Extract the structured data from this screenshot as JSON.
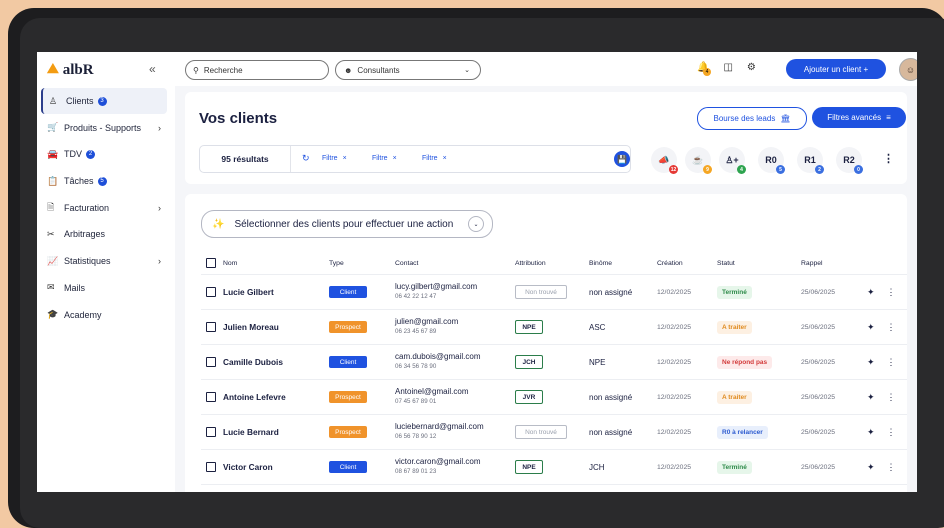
{
  "app": {
    "logo": "albR"
  },
  "sidebar": {
    "items": [
      {
        "label": "Clients",
        "icon": "user-icon",
        "badge": "3",
        "active": true,
        "chevron": false
      },
      {
        "label": "Produits - Supports",
        "icon": "cart-icon",
        "badge": "",
        "chevron": true
      },
      {
        "label": "TDV",
        "icon": "car-icon",
        "badge": "2",
        "chevron": false
      },
      {
        "label": "Tâches",
        "icon": "clipboard-icon",
        "badge": "5",
        "chevron": false
      },
      {
        "label": "Facturation",
        "icon": "invoice-icon",
        "badge": "",
        "chevron": true
      },
      {
        "label": "Arbitrages",
        "icon": "scissors-icon",
        "badge": "",
        "chevron": false
      },
      {
        "label": "Statistiques",
        "icon": "chart-icon",
        "badge": "",
        "chevron": true
      },
      {
        "label": "Mails",
        "icon": "mail-icon",
        "badge": "",
        "chevron": false
      },
      {
        "label": "Academy",
        "icon": "graduation-icon",
        "badge": "",
        "chevron": false
      }
    ]
  },
  "topbar": {
    "search_placeholder": "Recherche",
    "consultants_label": "Consultants",
    "add_client_label": "Ajouter un client +",
    "notification_count": "4"
  },
  "main": {
    "title": "Vos clients",
    "bourse_label": "Bourse des leads",
    "filtres_label": "Filtres avancés",
    "results": "95 résultats",
    "filters": [
      "Filtre",
      "Filtre",
      "Filtre"
    ],
    "stats": [
      {
        "label": "",
        "icon": "megaphone-icon",
        "count": "12",
        "color": "#e53935"
      },
      {
        "label": "",
        "icon": "pot-icon",
        "count": "9",
        "color": "#f5a623"
      },
      {
        "label": "",
        "icon": "add-person-icon",
        "count": "4",
        "color": "#2ea44f"
      },
      {
        "label": "R0",
        "icon": "",
        "count": "5",
        "color": "#3b6fe0"
      },
      {
        "label": "R1",
        "icon": "",
        "count": "2",
        "color": "#3b6fe0"
      },
      {
        "label": "R2",
        "icon": "",
        "count": "0",
        "color": "#3b6fe0"
      }
    ],
    "select_action": "Sélectionner des clients  pour effectuer une action"
  },
  "table": {
    "headers": [
      "Nom",
      "Type",
      "Contact",
      "Attribution",
      "Binôme",
      "Création",
      "Statut",
      "Rappel"
    ],
    "rows": [
      {
        "name": "Lucie Gilbert",
        "type": "Client",
        "email": "lucy.gilbert@gmail.com",
        "phone": "06 42 22 12 47",
        "attribution": "Non trouvé",
        "binome": "non assigné",
        "creation": "12/02/2025",
        "statut": "Terminé",
        "rappel": "25/06/2025"
      },
      {
        "name": "Julien Moreau",
        "type": "Prospect",
        "email": "julien@gmail.com",
        "phone": "06 23 45 67 89",
        "attribution": "NPE",
        "binome": "ASC",
        "creation": "12/02/2025",
        "statut": "A traiter",
        "rappel": "25/06/2025"
      },
      {
        "name": "Camille Dubois",
        "type": "Client",
        "email": "cam.dubois@gmail.com",
        "phone": "06 34 56 78 90",
        "attribution": "JCH",
        "binome": "NPE",
        "creation": "12/02/2025",
        "statut": "Ne répond pas",
        "rappel": "25/06/2025"
      },
      {
        "name": "Antoine Lefevre",
        "type": "Prospect",
        "email": "Antoinel@gmail.com",
        "phone": "07 45 67 89 01",
        "attribution": "JVR",
        "binome": "non assigné",
        "creation": "12/02/2025",
        "statut": "A traiter",
        "rappel": "25/06/2025"
      },
      {
        "name": "Lucie Bernard",
        "type": "Prospect",
        "email": "luciebernard@gmail.com",
        "phone": "06 56 78 90 12",
        "attribution": "Non trouvé",
        "binome": "non assigné",
        "creation": "12/02/2025",
        "statut": "R0 à relancer",
        "rappel": "25/06/2025"
      },
      {
        "name": "Victor Caron",
        "type": "Client",
        "email": "victor.caron@gmail.com",
        "phone": "08 67 89 01 23",
        "attribution": "NPE",
        "binome": "JCH",
        "creation": "12/02/2025",
        "statut": "Terminé",
        "rappel": "25/06/2025"
      }
    ]
  },
  "colors": {
    "accent": "#1f52e0",
    "client_type": "#1f52e0",
    "prospect_type": "#f0932b",
    "status_termine_bg": "#e6f6ea",
    "status_termine_fg": "#2e8b4a",
    "status_traiter_bg": "#fdf0e2",
    "status_traiter_fg": "#e08a1e",
    "status_nerepond_bg": "#fdeaea",
    "status_nerepond_fg": "#d33a3a",
    "status_relancer_bg": "#e8effc",
    "status_relancer_fg": "#2d5bd0"
  }
}
